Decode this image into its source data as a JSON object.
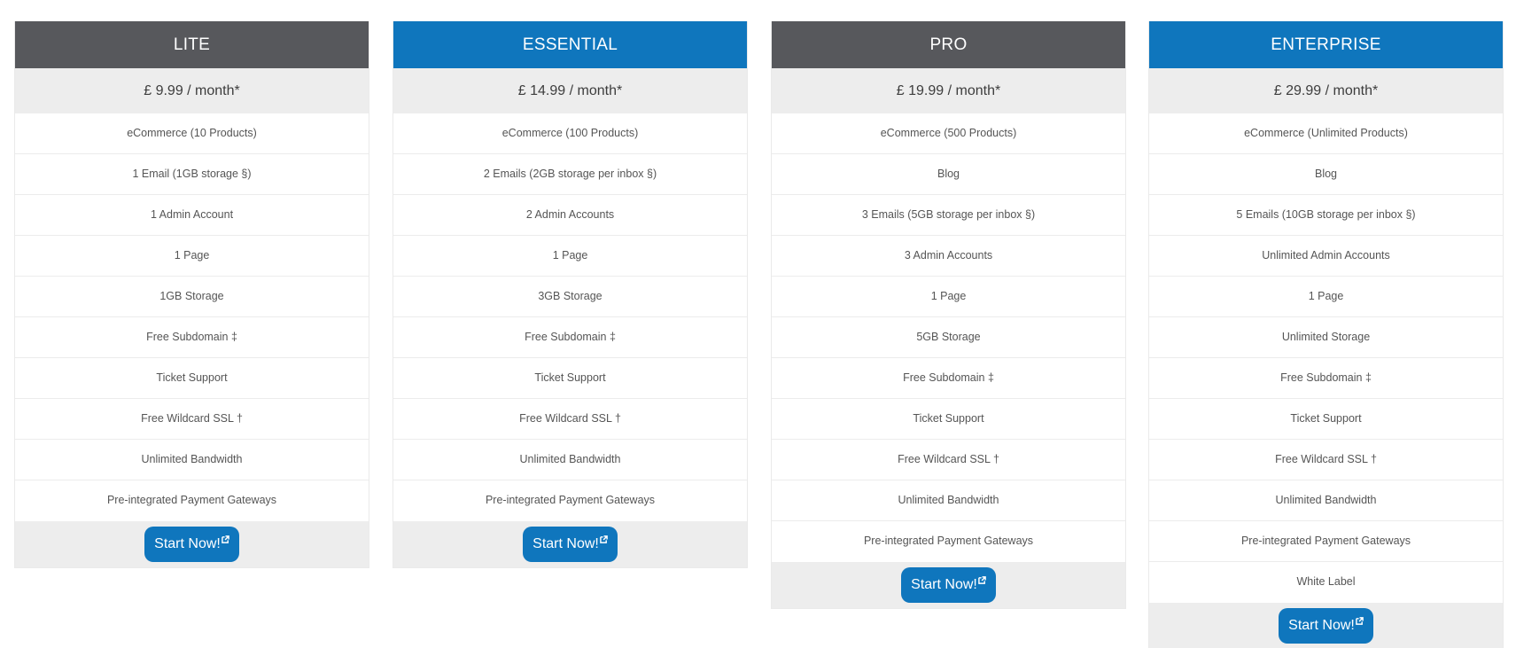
{
  "colors": {
    "header_dark": "#57585c",
    "header_blue": "#0f76bd",
    "price_bg": "#ededed",
    "button": "#0f76bd"
  },
  "plans": [
    {
      "name": "LITE",
      "header_style": "dark",
      "price": "£ 9.99 / month*",
      "features": [
        "eCommerce (10 Products)",
        "1 Email (1GB storage §)",
        "1 Admin Account",
        "1 Page",
        "1GB Storage",
        "Free Subdomain ‡",
        "Ticket Support",
        "Free Wildcard SSL †",
        "Unlimited Bandwidth",
        "Pre-integrated Payment Gateways"
      ],
      "button_label": "Start Now!",
      "button_icon": "external-link-icon"
    },
    {
      "name": "ESSENTIAL",
      "header_style": "blue",
      "price": "£ 14.99 / month*",
      "features": [
        "eCommerce (100 Products)",
        "2 Emails (2GB storage per inbox §)",
        "2 Admin Accounts",
        "1 Page",
        "3GB Storage",
        "Free Subdomain ‡",
        "Ticket Support",
        "Free Wildcard SSL †",
        "Unlimited Bandwidth",
        "Pre-integrated Payment Gateways"
      ],
      "button_label": "Start Now!",
      "button_icon": "external-link-icon"
    },
    {
      "name": "PRO",
      "header_style": "dark",
      "price": "£ 19.99 / month*",
      "features": [
        "eCommerce (500 Products)",
        "Blog",
        "3 Emails (5GB storage per inbox §)",
        "3 Admin Accounts",
        "1 Page",
        "5GB Storage",
        "Free Subdomain ‡",
        "Ticket Support",
        "Free Wildcard SSL †",
        "Unlimited Bandwidth",
        "Pre-integrated Payment Gateways"
      ],
      "button_label": "Start Now!",
      "button_icon": "external-link-icon"
    },
    {
      "name": "ENTERPRISE",
      "header_style": "blue",
      "price": "£ 29.99 / month*",
      "features": [
        "eCommerce (Unlimited Products)",
        "Blog",
        "5 Emails (10GB storage per inbox §)",
        "Unlimited Admin Accounts",
        "1 Page",
        "Unlimited Storage",
        "Free Subdomain ‡",
        "Ticket Support",
        "Free Wildcard SSL †",
        "Unlimited Bandwidth",
        "Pre-integrated Payment Gateways",
        "White Label"
      ],
      "button_label": "Start Now!",
      "button_icon": "external-link-icon"
    }
  ]
}
